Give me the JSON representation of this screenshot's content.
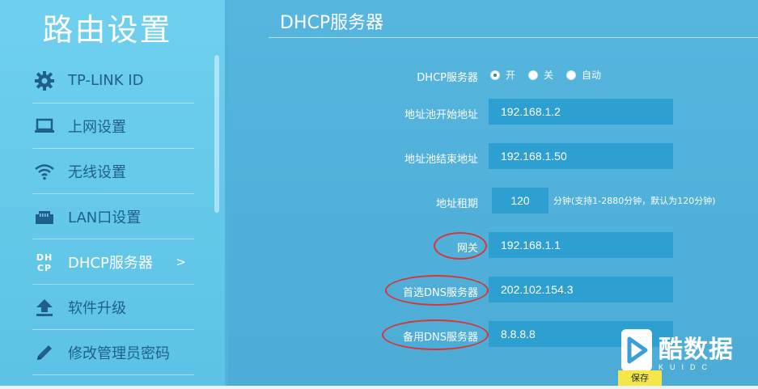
{
  "sidebar": {
    "title": "路由设置",
    "items": [
      {
        "label": "TP-LINK ID",
        "icon": "gear-icon"
      },
      {
        "label": "上网设置",
        "icon": "laptop-icon"
      },
      {
        "label": "无线设置",
        "icon": "wifi-icon"
      },
      {
        "label": "LAN口设置",
        "icon": "lan-port-icon"
      },
      {
        "label": "DHCP服务器",
        "icon": "dhcp-icon",
        "icon_text": "DHCP",
        "arrow": ">",
        "active": true
      },
      {
        "label": "软件升级",
        "icon": "upload-icon"
      },
      {
        "label": "修改管理员密码",
        "icon": "pencil-icon"
      }
    ]
  },
  "main": {
    "title": "DHCP服务器",
    "dhcp": {
      "label": "DHCP服务器",
      "options": [
        "开",
        "关",
        "自动"
      ],
      "selected": "开"
    },
    "pool_start": {
      "label": "地址池开始地址",
      "value": "192.168.1.2"
    },
    "pool_end": {
      "label": "地址池结束地址",
      "value": "192.168.1.50"
    },
    "lease": {
      "label": "地址租期",
      "value": "120",
      "hint": "分钟(支持1-2880分钟，默认为120分钟)"
    },
    "gateway": {
      "label": "网关",
      "value": "192.168.1.1"
    },
    "dns_primary": {
      "label": "首选DNS服务器",
      "value": "202.102.154.3"
    },
    "dns_secondary": {
      "label": "备用DNS服务器",
      "value": "8.8.8.8"
    },
    "save_label": "保存"
  },
  "watermark": {
    "text": "酷数据",
    "subtext": "KUIDC"
  },
  "colors": {
    "highlight_ellipse": "#d6353a",
    "field_bg": "#2e9fd1",
    "save_button": "#f3e74a"
  }
}
